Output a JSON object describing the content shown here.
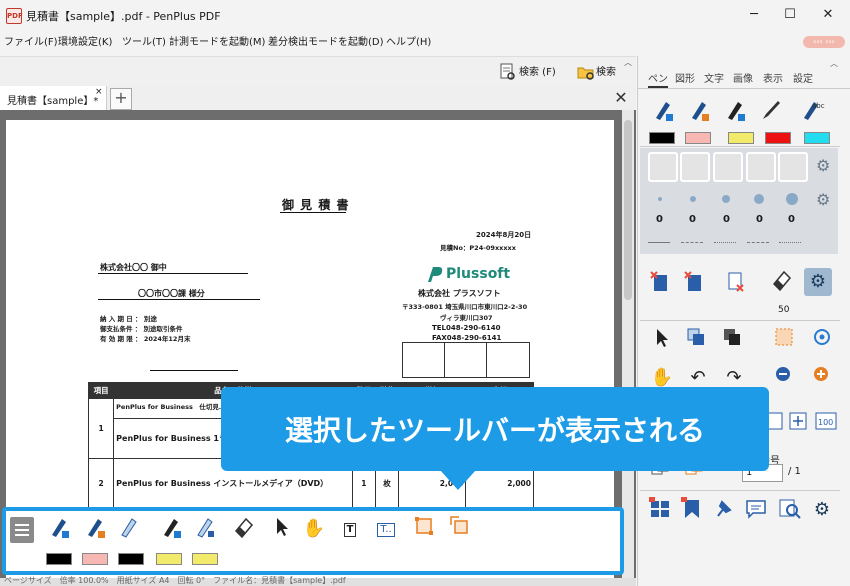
{
  "window": {
    "title": "見積書【sample】.pdf - PenPlus PDF",
    "icon_label": "PDF",
    "minimize": "─",
    "maximize": "☐",
    "close": "✕"
  },
  "menu": [
    {
      "label": "ファイル(F)"
    },
    {
      "label": "環境設定(K)"
    },
    {
      "label": "ツール(T)"
    },
    {
      "label": "計測モードを起動(M)"
    },
    {
      "label": "差分検出モードを起動(D)"
    },
    {
      "label": "ヘルプ(H)"
    }
  ],
  "mini_pill": "‹‹‹ ›››",
  "search": {
    "search_label": "検索 (F)",
    "search2_label": "検索"
  },
  "tab": {
    "label": "見積書【sample】*",
    "close": "×",
    "new_tab": "+",
    "close_doc": "✕"
  },
  "document": {
    "title": "御 見 積 書",
    "date": "2024年8月20日",
    "quote_no": "見積No：P24-09xxxxx",
    "recipient": "株式会社〇〇 御中",
    "department": "〇〇市〇〇課 様分",
    "logo_text": "Plussoft",
    "company": "株式会社 プラスソフト",
    "address1": "〒333-0801 埼玉県川口市東川口2-2-30",
    "address2": "ヴィラ東川口307",
    "tel": "TEL048-290-6140",
    "fax": "FAX048-290-6141",
    "delivery_label": "納 入 期 日 ： 別途",
    "payment_label": "御支払条件 ： 別途取引条件",
    "expiry_label": "有 効 期 限 ： 2024年12月末",
    "table_headers": [
      "項目",
      "品名・仕様",
      "数量",
      "単位",
      "単価",
      "金額"
    ],
    "rows": [
      {
        "no": "",
        "name": "PenPlus for Business　仕切見…",
        "qty": "",
        "unit": "",
        "price": "",
        "amount": ""
      },
      {
        "no": "1",
        "name": "PenPlus for Business 1ラ…",
        "qty": "",
        "unit": "",
        "price": "",
        "amount": ""
      },
      {
        "no": "2",
        "name": "PenPlus for Business インストールメディア（DVD）",
        "qty": "1",
        "unit": "枚",
        "price": "2,000",
        "amount": "2,000"
      }
    ]
  },
  "right_panel": {
    "tabs": [
      "ペン",
      "図形",
      "文字",
      "画像",
      "表示",
      "設定"
    ],
    "active_tab": "ペン",
    "swatch_colors": [
      "#000000",
      "#f7b8b3",
      "#f2ea6a",
      "#ee1111",
      "#22ddee"
    ],
    "zeros": [
      "0",
      "0",
      "0",
      "0",
      "0"
    ],
    "eraser_size": "50",
    "page_label": "番号",
    "page_current": "1",
    "page_total": "/ 1"
  },
  "callout": {
    "text": "選択したツールバーが表示される"
  },
  "toolbar": {
    "swatch_colors": [
      "#000000",
      "#f7b8b3",
      "#000000",
      "#f2ea6a",
      "#f2ea6a"
    ],
    "text_tool_label": "T",
    "text_tool2_label": "T.."
  },
  "status": {
    "text": "ページサイズ　倍率 100.0%　用紙サイズ A4　回転 0°　ファイル名：見積書【sample】.pdf"
  }
}
